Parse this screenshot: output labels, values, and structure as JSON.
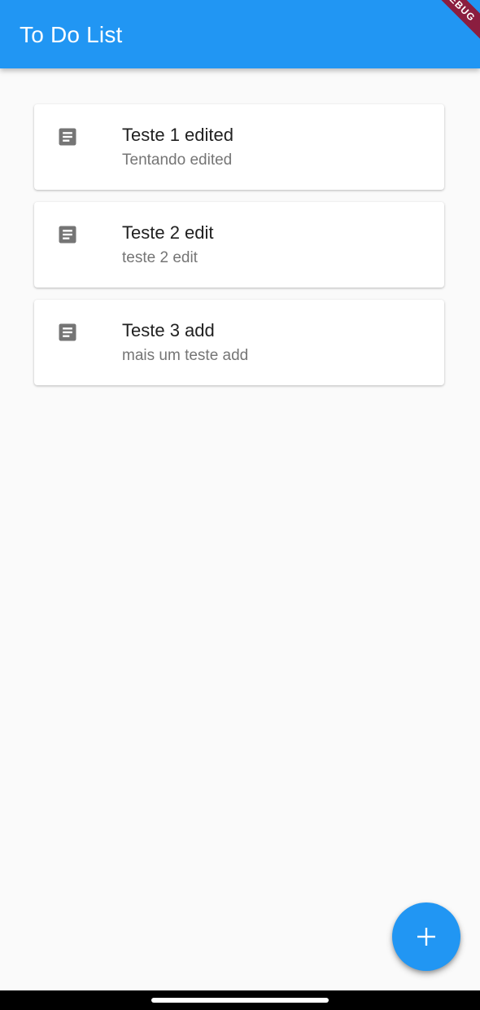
{
  "app_bar": {
    "title": "To Do List",
    "debug_banner": "DEBUG",
    "color": "#2196f3"
  },
  "items": [
    {
      "title": "Teste 1 edited",
      "subtitle": "Tentando edited",
      "icon": "note-icon"
    },
    {
      "title": "Teste 2 edit",
      "subtitle": "teste 2 edit",
      "icon": "note-icon"
    },
    {
      "title": "Teste 3 add",
      "subtitle": "mais um teste add",
      "icon": "note-icon"
    }
  ],
  "fab": {
    "icon": "plus-icon",
    "color": "#2196f3"
  }
}
